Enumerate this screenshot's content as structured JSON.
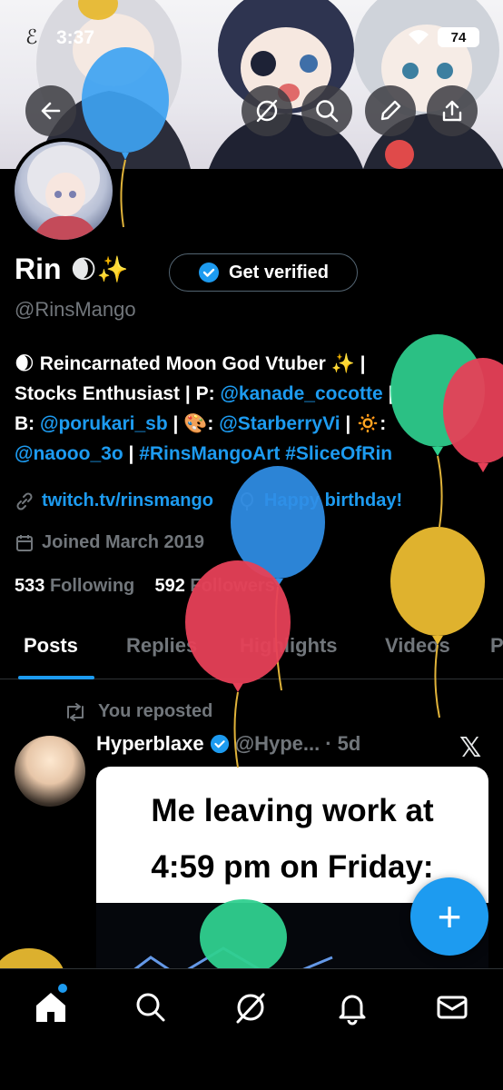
{
  "status": {
    "time": "3:37",
    "battery": "74"
  },
  "header": {
    "back_icon": "arrow-left-icon",
    "grok_icon": "grok-icon",
    "search_icon": "search-icon",
    "edit_icon": "pencil-icon",
    "share_icon": "share-icon"
  },
  "profile": {
    "name": "Rin",
    "name_emoji": "🌒✨",
    "verify_label": "Get verified",
    "handle": "@RinsMango",
    "bio": {
      "line1_emoji": "🌒",
      "line1": "Reincarnated Moon God Vtuber ✨ | ",
      "line2_a": "Stocks Enthusiast | P: ",
      "line2_link": "@kanade_cocotte",
      "line2_b": " |",
      "line3_a": "B: ",
      "line3_link1": "@porukari_sb",
      "line3_b": " | 🎨: ",
      "line3_link2": "@StarberryVi",
      "line3_c": " | 🔅:",
      "line4_link1": "@naooo_3o",
      "line4_sep": " | ",
      "line4_link2": "#RinsMangoArt",
      "line4_link3": "#SliceOfRin"
    },
    "website": "twitch.tv/rinsmango",
    "birthday": "Happy birthday!",
    "joined": "Joined March 2019",
    "following_count": "533",
    "following_label": "Following",
    "followers_count": "592",
    "followers_label": "Followers"
  },
  "tabs": [
    "Posts",
    "Replies",
    "Highlights",
    "Videos",
    "P"
  ],
  "post": {
    "repost_label": "You reposted",
    "author_name": "Hyperblaxe",
    "author_handle": "@Hype...",
    "time": "· 5d",
    "media_text_line1": "Me leaving work at",
    "media_text_line2": "4:59 pm on Friday:"
  },
  "fab_label": "+",
  "bottom_nav": [
    "home-icon",
    "search-icon",
    "grok-icon",
    "bell-icon",
    "mail-icon"
  ],
  "colors": {
    "accent": "#1d9bf0",
    "background": "#000000",
    "muted": "#71767b"
  }
}
